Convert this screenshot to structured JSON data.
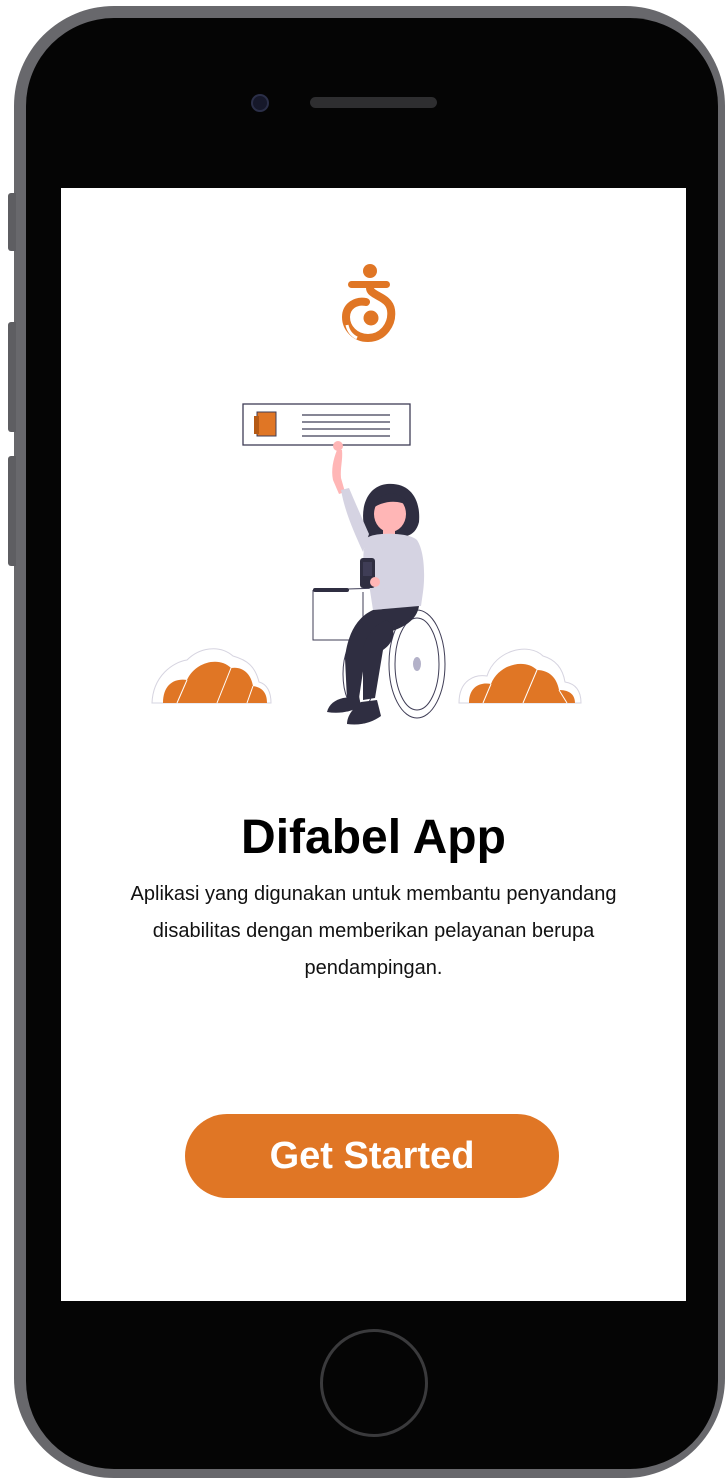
{
  "app": {
    "title": "Difabel App",
    "description": "Aplikasi yang digunakan untuk membantu penyandang disabilitas dengan memberikan pelayanan berupa pendampingan.",
    "cta_label": "Get Started",
    "logo_icon": "accessibility-logo-icon",
    "illustration": "woman-in-wheelchair-illustration"
  },
  "colors": {
    "accent": "#e07625",
    "title": "#000000",
    "text": "#111111",
    "screen_bg": "#ffffff",
    "device_frame": "#68686c",
    "device_body": "#050505"
  }
}
